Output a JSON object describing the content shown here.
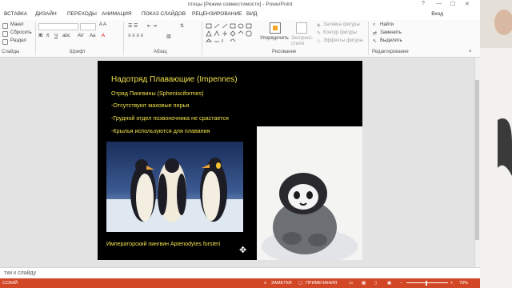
{
  "window": {
    "title": "птицы [Режим совместимости] - PowerPoint",
    "controls": [
      "?",
      "—",
      "☐",
      "✕"
    ]
  },
  "ribbon_tabs": [
    "ВСТАВКА",
    "ДИЗАЙН",
    "ПЕРЕХОДЫ",
    "АНИМАЦИЯ",
    "ПОКАЗ СЛАЙДОВ",
    "РЕЦЕНЗИРОВАНИЕ",
    "ВИД"
  ],
  "login": "Вход",
  "ribbon": {
    "slides": {
      "layout": "Макет",
      "reset": "Сбросить",
      "section": "Раздел",
      "group": "Слайды"
    },
    "font": {
      "group": "Шрифт"
    },
    "paragraph": {
      "group": "Абзац"
    },
    "drawing": {
      "arrange": "Упорядочить",
      "quick_styles": "Экспресс-стили",
      "fill": "Заливка фигуры",
      "outline": "Контур фигуры",
      "effects": "Эффекты фигуры",
      "group": "Рисование"
    },
    "editing": {
      "find": "Найти",
      "replace": "Заменить",
      "select": "Выделить",
      "group": "Редактирование"
    }
  },
  "slide": {
    "title": "Надотряд Плавающие (Impennes)",
    "lines": [
      "Отряд Пингвины (Sphenisciformes)",
      "-Отсутствуют маховые перья",
      "-Грудной отдел позвоночника не срастается",
      "-Крылья используются для плавания"
    ],
    "caption": "Императорский пингвин Aptenodytes forsteri"
  },
  "notes": {
    "text": "тки к слайду"
  },
  "status": {
    "left": "ССКИЙ",
    "notes": "ЗАМЕТКИ",
    "comments": "ПРИМЕЧАНИЯ",
    "zoom": "70%"
  }
}
